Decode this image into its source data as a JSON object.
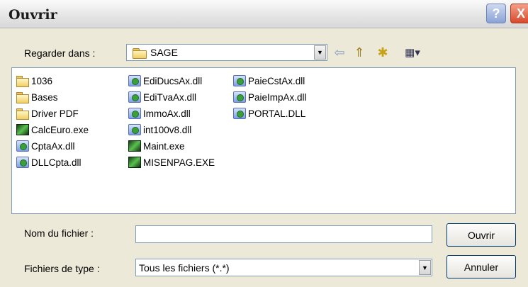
{
  "window": {
    "title": "Ouvrir"
  },
  "titlebar": {
    "help_label": "?",
    "close_label": "X"
  },
  "look_in": {
    "label": "Regarder dans :",
    "value": "SAGE"
  },
  "toolbar": {
    "back_glyph": "⇦",
    "up_glyph": "⇑",
    "newfolder_glyph": "✱",
    "views_glyph": "▦▾"
  },
  "files": {
    "col1": [
      {
        "name": "1036",
        "type": "folder"
      },
      {
        "name": "Bases",
        "type": "folder"
      },
      {
        "name": "Driver PDF",
        "type": "folder"
      },
      {
        "name": "CalcEuro.exe",
        "type": "exe"
      },
      {
        "name": "CptaAx.dll",
        "type": "dll"
      },
      {
        "name": "DLLCpta.dll",
        "type": "dll"
      }
    ],
    "col2": [
      {
        "name": "EdiDucsAx.dll",
        "type": "dll"
      },
      {
        "name": "EdiTvaAx.dll",
        "type": "dll"
      },
      {
        "name": "ImmoAx.dll",
        "type": "dll"
      },
      {
        "name": "int100v8.dll",
        "type": "dll"
      },
      {
        "name": "Maint.exe",
        "type": "exe"
      },
      {
        "name": "MISENPAG.EXE",
        "type": "exe"
      }
    ],
    "col3": [
      {
        "name": "PaieCstAx.dll",
        "type": "dll"
      },
      {
        "name": "PaieImpAx.dll",
        "type": "dll"
      },
      {
        "name": "PORTAL.DLL",
        "type": "dll"
      }
    ]
  },
  "filename": {
    "label": "Nom du fichier :",
    "value": ""
  },
  "filetype": {
    "label": "Fichiers de type :",
    "value": "Tous les fichiers (*.*)"
  },
  "buttons": {
    "open": "Ouvrir",
    "cancel": "Annuler"
  }
}
